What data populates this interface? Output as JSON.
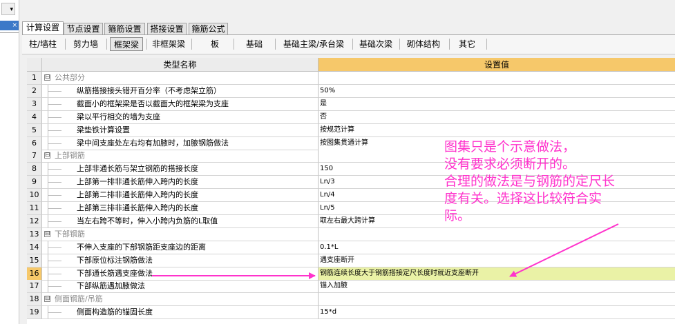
{
  "tabs": [
    "计算设置",
    "节点设置",
    "箍筋设置",
    "搭接设置",
    "箍筋公式"
  ],
  "active_tab": 0,
  "subtabs": [
    "柱/墙柱",
    "剪力墙",
    "框架梁",
    "非框架梁",
    "板",
    "基础",
    "基础主梁/承台梁",
    "基础次梁",
    "砌体结构",
    "其它"
  ],
  "active_subtab": 2,
  "grid": {
    "col_name_header": "类型名称",
    "col_value_header": "设置值",
    "rows": [
      {
        "num": "1",
        "name": "公共部分",
        "value": "",
        "group": true
      },
      {
        "num": "2",
        "name": "纵筋搭接接头错开百分率（不考虑架立筋）",
        "value": "50%"
      },
      {
        "num": "3",
        "name": "截面小的框架梁是否以截面大的框架梁为支座",
        "value": "是"
      },
      {
        "num": "4",
        "name": "梁以平行相交的墙为支座",
        "value": "否"
      },
      {
        "num": "5",
        "name": "梁垫铁计算设置",
        "value": "按规范计算"
      },
      {
        "num": "6",
        "name": "梁中间支座处左右均有加腋时，加腋钢筋做法",
        "value": "按图集贯通计算"
      },
      {
        "num": "7",
        "name": "上部钢筋",
        "value": "",
        "group": true
      },
      {
        "num": "8",
        "name": "上部非通长筋与架立钢筋的搭接长度",
        "value": "150"
      },
      {
        "num": "9",
        "name": "上部第一排非通长筋伸入跨内的长度",
        "value": "Ln/3"
      },
      {
        "num": "10",
        "name": "上部第二排非通长筋伸入跨内的长度",
        "value": "Ln/4"
      },
      {
        "num": "11",
        "name": "上部第三排非通长筋伸入跨内的长度",
        "value": "Ln/5"
      },
      {
        "num": "12",
        "name": "当左右跨不等时，伸入小跨内负筋的L取值",
        "value": "取左右最大跨计算"
      },
      {
        "num": "13",
        "name": "下部钢筋",
        "value": "",
        "group": true
      },
      {
        "num": "14",
        "name": "不伸入支座的下部钢筋距支座边的距离",
        "value": "0.1*L"
      },
      {
        "num": "15",
        "name": "下部原位标注钢筋做法",
        "value": "遇支座断开"
      },
      {
        "num": "16",
        "name": "下部通长筋遇支座做法",
        "value": "钢筋连续长度大于钢筋搭接定尺长度时就近支座断开",
        "highlight": true
      },
      {
        "num": "17",
        "name": "下部纵筋遇加腋做法",
        "value": "锚入加腋"
      },
      {
        "num": "18",
        "name": "侧面钢筋/吊筋",
        "value": "",
        "group": true
      },
      {
        "num": "19",
        "name": "侧面构造筋的锚固长度",
        "value": "15*d"
      }
    ]
  },
  "annotation": {
    "color": "#ff33cc",
    "lines": [
      "图集只是个示意做法，",
      "没有要求必须断开的。",
      "合理的做法是与钢筋的定尺长",
      "度有关。选择这比较符合实",
      "际。"
    ]
  },
  "left_panel": {
    "close_glyph": "×",
    "dropdown_glyph": "▾"
  },
  "icons": {
    "collapse": "⊟",
    "dropdown": "chevron-down-icon",
    "close": "close-icon"
  }
}
